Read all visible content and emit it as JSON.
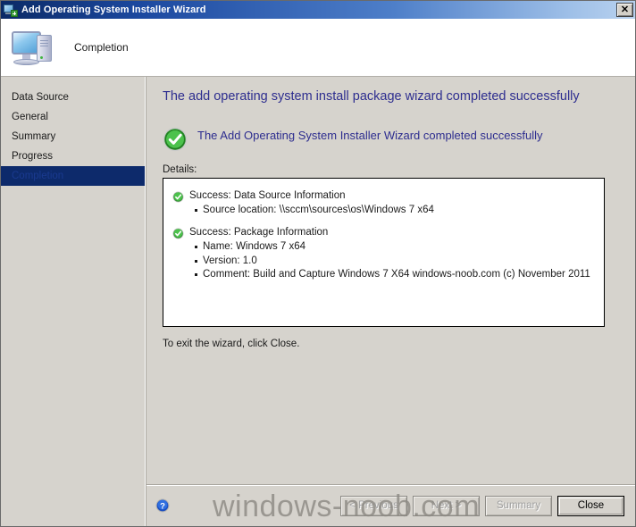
{
  "window": {
    "title": "Add Operating System Installer Wizard",
    "title_icon": "computer-add-icon",
    "close_label": "✕"
  },
  "header": {
    "icon": "computer-icon",
    "title": "Completion"
  },
  "sidebar": {
    "items": [
      {
        "label": "Data Source",
        "active": false
      },
      {
        "label": "General",
        "active": false
      },
      {
        "label": "Summary",
        "active": false
      },
      {
        "label": "Progress",
        "active": false
      },
      {
        "label": "Completion",
        "active": true
      }
    ]
  },
  "main": {
    "page_heading": "The add operating system install package wizard completed successfully",
    "result_icon": "success-check-icon",
    "result_text": "The Add Operating System Installer Wizard completed successfully",
    "details_label": "Details:",
    "details": [
      {
        "icon": "success-check-icon",
        "heading": "Success: Data Source Information",
        "bullets": [
          "Source location: \\\\sccm\\sources\\os\\Windows 7 x64"
        ]
      },
      {
        "icon": "success-check-icon",
        "heading": "Success: Package Information",
        "bullets": [
          "Name: Windows 7 x64",
          "Version: 1.0",
          "Comment: Build and Capture Windows 7 X64 windows-noob.com (c) November 2011"
        ]
      }
    ],
    "exit_note": "To exit the wizard, click Close."
  },
  "footer": {
    "help_icon": "help-question-icon",
    "buttons": [
      {
        "label": "< Previous",
        "enabled": false
      },
      {
        "label": "Next >",
        "enabled": false
      },
      {
        "label": "Summary",
        "enabled": false
      },
      {
        "label": "Close",
        "enabled": true
      }
    ]
  },
  "watermark": {
    "text": "windows-noob.com"
  },
  "colors": {
    "titlebar_start": "#0b2a66",
    "titlebar_end": "#b9d2ef",
    "dialog_bg": "#d6d3cd",
    "heading_blue": "#2d2d8f",
    "nav_active_bg": "#0d2a6b",
    "success_green": "#3fa93f"
  }
}
